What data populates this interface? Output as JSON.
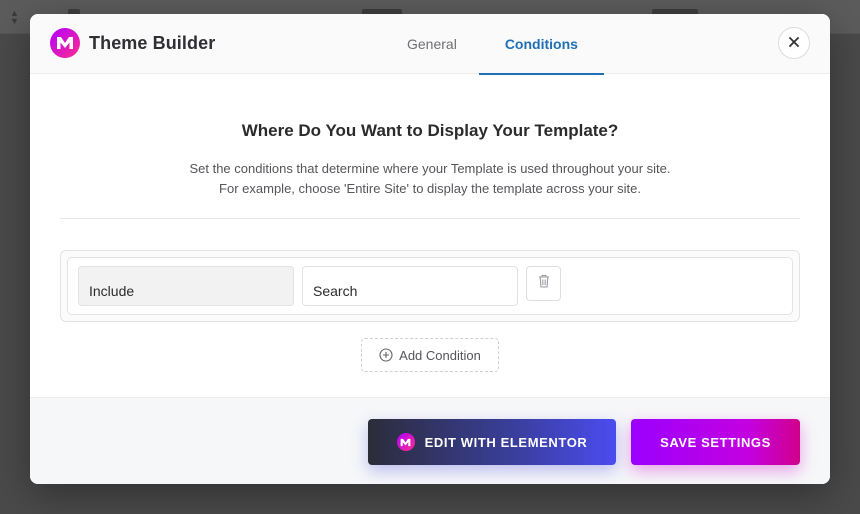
{
  "modal": {
    "app_title": "Theme Builder",
    "tabs": [
      {
        "label": "General",
        "active": false
      },
      {
        "label": "Conditions",
        "active": true
      }
    ],
    "close_icon": "close-icon",
    "content": {
      "title": "Where Do You Want to Display Your Template?",
      "description_line1": "Set the conditions that determine where your Template is used throughout your site.",
      "description_line2": "For example, choose 'Entire Site' to display the template across your site."
    },
    "condition": {
      "type_value": "Include",
      "target_value": "Search",
      "delete_icon": "trash-icon"
    },
    "add_condition_label": "Add Condition",
    "footer": {
      "edit_button_label": "EDIT WITH ELEMENTOR",
      "save_button_label": "SAVE SETTINGS"
    }
  },
  "colors": {
    "accent": "#1f6fb5",
    "brand_gradient_start": "#b100ff",
    "brand_gradient_end": "#ff2d8d"
  }
}
